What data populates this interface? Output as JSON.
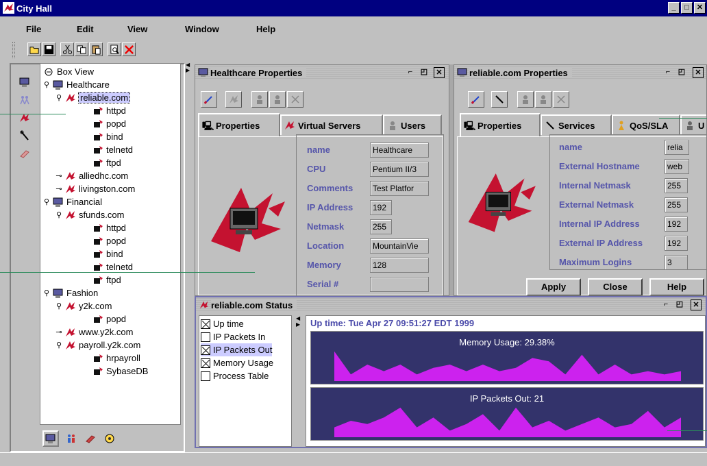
{
  "window": {
    "title": "City Hall"
  },
  "menu": [
    "File",
    "Edit",
    "View",
    "Window",
    "Help"
  ],
  "toolbar": {
    "buttons": [
      "open-icon",
      "save-icon",
      "cut-icon",
      "copy-icon",
      "paste-icon",
      "preview-icon",
      "delete-icon"
    ]
  },
  "tree": {
    "items": [
      {
        "label": "Box View",
        "icon": "box-view-icon",
        "pin": ""
      },
      {
        "label": "Healthcare",
        "icon": "group-icon",
        "pin": "pin"
      },
      {
        "label": "reliable.com",
        "icon": "server-icon",
        "pin": "pin"
      },
      {
        "label": "httpd",
        "icon": "service-icon",
        "pin": ""
      },
      {
        "label": "popd",
        "icon": "service-icon",
        "pin": ""
      },
      {
        "label": "bind",
        "icon": "service-icon",
        "pin": ""
      },
      {
        "label": "telnetd",
        "icon": "service-icon",
        "pin": ""
      },
      {
        "label": "ftpd",
        "icon": "service-icon",
        "pin": ""
      },
      {
        "label": "alliedhc.com",
        "icon": "server-icon",
        "pin": "key"
      },
      {
        "label": "livingston.com",
        "icon": "server-icon",
        "pin": "key"
      },
      {
        "label": "Financial",
        "icon": "group-icon",
        "pin": "pin"
      },
      {
        "label": "sfunds.com",
        "icon": "server-icon",
        "pin": "pin"
      },
      {
        "label": "httpd",
        "icon": "service-icon",
        "pin": ""
      },
      {
        "label": "popd",
        "icon": "service-icon",
        "pin": ""
      },
      {
        "label": "bind",
        "icon": "service-icon",
        "pin": ""
      },
      {
        "label": "telnetd",
        "icon": "service-icon",
        "pin": ""
      },
      {
        "label": "ftpd",
        "icon": "service-icon",
        "pin": ""
      },
      {
        "label": "Fashion",
        "icon": "group-icon",
        "pin": "pin"
      },
      {
        "label": "y2k.com",
        "icon": "server-icon",
        "pin": "pin"
      },
      {
        "label": "popd",
        "icon": "service-icon",
        "pin": ""
      },
      {
        "label": "www.y2k.com",
        "icon": "server-icon",
        "pin": "key"
      },
      {
        "label": "payroll.y2k.com",
        "icon": "server-icon",
        "pin": "pin"
      },
      {
        "label": "hrpayroll",
        "icon": "service-icon",
        "pin": ""
      },
      {
        "label": "SybaseDB",
        "icon": "service-icon",
        "pin": ""
      }
    ]
  },
  "healthcare": {
    "title": "Healthcare Properties",
    "tabs": [
      "Properties",
      "Virtual Servers",
      "Users"
    ],
    "fields": [
      {
        "label": "name",
        "value": "Healthcare"
      },
      {
        "label": "CPU",
        "value": "Pentium II/3"
      },
      {
        "label": "Comments",
        "value": "Test Platfor"
      },
      {
        "label": "IP Address",
        "value": "192"
      },
      {
        "label": "Netmask",
        "value": "255"
      },
      {
        "label": "Location",
        "value": "MountainVie"
      },
      {
        "label": "Memory",
        "value": "128"
      },
      {
        "label": "Serial #",
        "value": ""
      }
    ]
  },
  "reliable": {
    "title": "reliable.com Properties",
    "tabs": [
      "Properties",
      "Services",
      "QoS/SLA",
      "U"
    ],
    "fields": [
      {
        "label": "name",
        "value": "relia"
      },
      {
        "label": "External Hostname",
        "value": "web"
      },
      {
        "label": "Internal Netmask",
        "value": "255"
      },
      {
        "label": "External Netmask",
        "value": "255"
      },
      {
        "label": "Internal IP Address",
        "value": "192"
      },
      {
        "label": "External IP Address",
        "value": "192"
      },
      {
        "label": "Maximum Logins",
        "value": "3"
      }
    ],
    "buttons": [
      "Apply",
      "Close",
      "Help"
    ]
  },
  "status": {
    "title": "reliable.com Status",
    "checks": [
      {
        "label": "Up time",
        "checked": true
      },
      {
        "label": "IP Packets In",
        "checked": false
      },
      {
        "label": "IP Packets Out",
        "checked": true
      },
      {
        "label": "Memory Usage",
        "checked": true
      },
      {
        "label": "Process Table",
        "checked": false
      }
    ],
    "uptime": "Up time: Tue Apr 27 09:51:27 EDT 1999",
    "memory_label": "Memory Usage: 29.38%",
    "packets_label": "IP Packets Out: 21"
  },
  "chart_data": [
    {
      "type": "area",
      "title": "Memory Usage: 29.38%",
      "x": [
        0,
        1,
        2,
        3,
        4,
        5,
        6,
        7,
        8,
        9,
        10,
        11,
        12,
        13,
        14,
        15,
        16,
        17,
        18,
        19,
        20,
        21
      ],
      "values": [
        0.9,
        0.2,
        0.5,
        0.3,
        0.5,
        0.2,
        0.4,
        0.5,
        0.3,
        0.5,
        0.3,
        0.4,
        0.7,
        0.6,
        0.2,
        0.8,
        0.2,
        0.5,
        0.2,
        0.3,
        0.2,
        0.3
      ]
    },
    {
      "type": "area",
      "title": "IP Packets Out: 21",
      "x": [
        0,
        1,
        2,
        3,
        4,
        5,
        6,
        7,
        8,
        9,
        10,
        11,
        12,
        13,
        14,
        15,
        16,
        17,
        18,
        19,
        20,
        21
      ],
      "values": [
        0.3,
        0.5,
        0.4,
        0.6,
        0.9,
        0.3,
        0.6,
        0.2,
        0.4,
        0.7,
        0.2,
        0.9,
        0.3,
        0.5,
        0.2,
        0.4,
        0.6,
        0.3,
        0.4,
        0.8,
        0.3,
        0.6
      ]
    }
  ],
  "colors": {
    "title": "#000080",
    "chart_bg": "#33336b",
    "chart_fill": "#cc22ee",
    "label": "#5555aa",
    "logo_red": "#c41230"
  }
}
